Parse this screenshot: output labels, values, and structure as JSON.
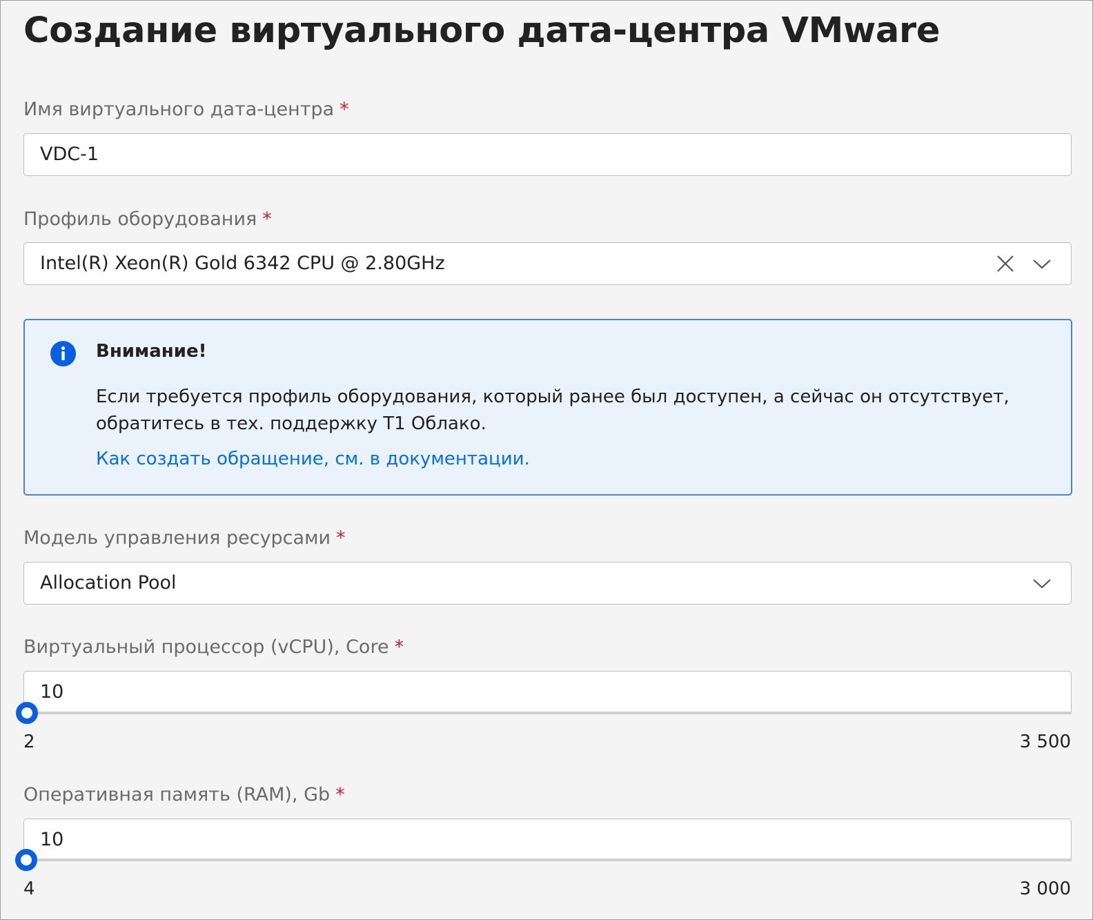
{
  "page": {
    "title": "Создание виртуального дата-центра VMware"
  },
  "required_mark": "*",
  "vdc_name": {
    "label": "Имя виртуального дата-центра",
    "value": "VDC-1"
  },
  "hardware_profile": {
    "label": "Профиль оборудования",
    "value": "Intel(R) Xeon(R) Gold 6342 CPU @ 2.80GHz"
  },
  "alert": {
    "heading": "Внимание!",
    "text": "Если требуется профиль оборудования, который ранее был доступен, а сейчас он отсутствует, обратитесь в тех. поддержку Т1 Облако.",
    "link": "Как создать обращение, см. в документации."
  },
  "resource_model": {
    "label": "Модель управления ресурсами",
    "value": "Allocation Pool"
  },
  "vcpu": {
    "label": "Виртуальный процессор (vCPU), Core",
    "value": "10",
    "min": "2",
    "max": "3 500",
    "level": 0.0023
  },
  "ram": {
    "label": "Оперативная память (RAM), Gb",
    "value": "10",
    "min": "4",
    "max": "3 000",
    "level": 0.002
  },
  "colors": {
    "accent": "#0a5fe0",
    "link": "#0a6ee0",
    "required": "#d0202a",
    "alert_bg": "#eaf2fb",
    "alert_border": "#4a84d4"
  },
  "icons": {
    "clear": "close-icon",
    "dropdown": "chevron-down-icon",
    "info": "info-icon"
  }
}
